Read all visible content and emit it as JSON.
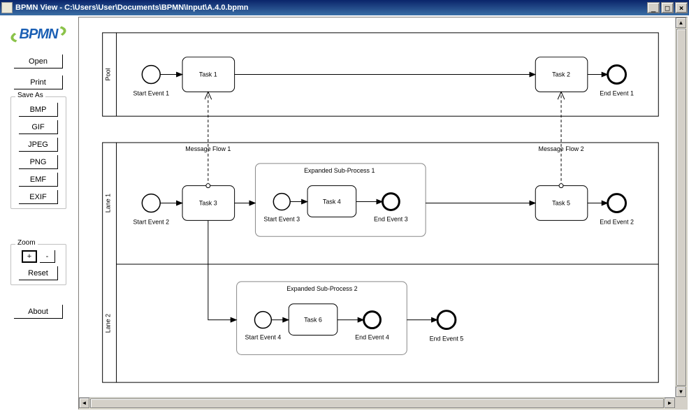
{
  "titlebar": {
    "app_icon_text": "",
    "title": "BPMN View - C:\\Users\\User\\Documents\\BPMN\\Input\\A.4.0.bpmn",
    "min": "_",
    "max": "□",
    "close": "×"
  },
  "logo_text": "BPMN",
  "buttons": {
    "open": "Open",
    "print": "Print",
    "about": "About"
  },
  "save_as": {
    "label": "Save As",
    "bmp": "BMP",
    "gif": "GIF",
    "jpeg": "JPEG",
    "png": "PNG",
    "emf": "EMF",
    "exif": "EXIF"
  },
  "zoom": {
    "label": "Zoom",
    "plus": "+",
    "minus": "-",
    "reset": "Reset"
  },
  "diagram": {
    "pool": "Pool",
    "lane1": "Lane 1",
    "lane2": "Lane 2",
    "start1": "Start Event 1",
    "start2": "Start Event 2",
    "start3": "Start Event 3",
    "start4": "Start Event 4",
    "end1": "End Event 1",
    "end2": "End Event 2",
    "end3": "End Event 3",
    "end4": "End Event 4",
    "end5": "End Event 5",
    "task1": "Task 1",
    "task2": "Task 2",
    "task3": "Task 3",
    "task4": "Task 4",
    "task5": "Task 5",
    "task6": "Task 6",
    "sub1": "Expanded Sub-Process 1",
    "sub2": "Expanded Sub-Process 2",
    "msg1": "Message Flow 1",
    "msg2": "Message Flow 2"
  }
}
